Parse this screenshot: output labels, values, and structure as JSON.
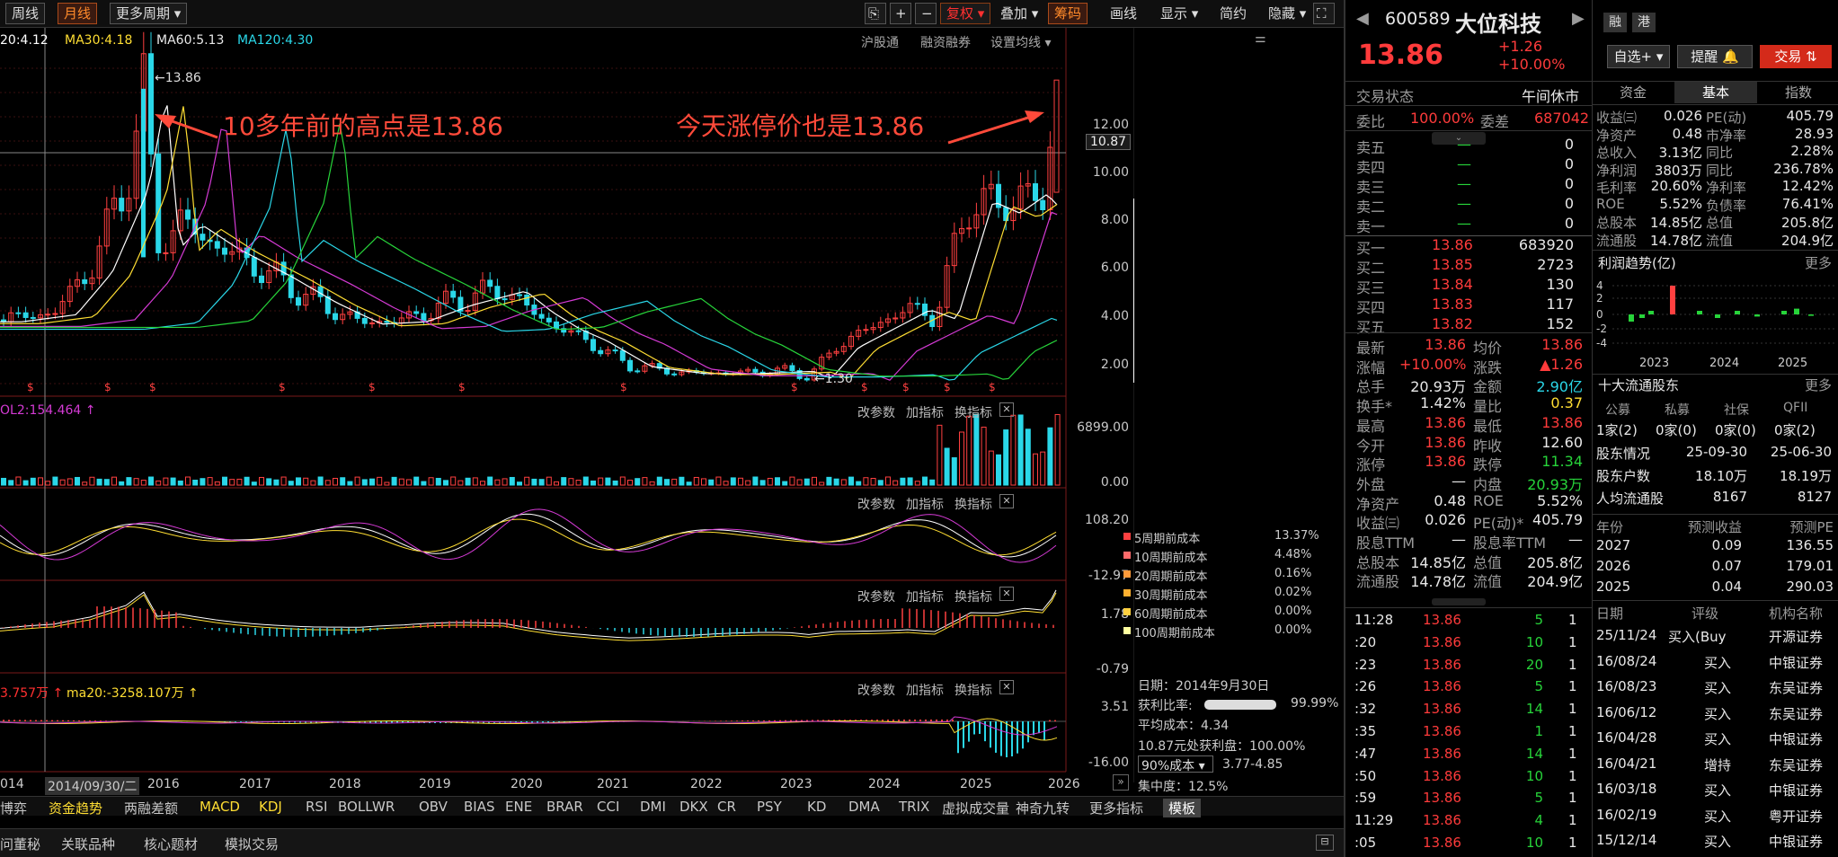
{
  "toolbar": {
    "buttons": [
      "周线",
      "月线",
      "更多周期",
      "复权",
      "叠加",
      "筹码",
      "画线",
      "显示",
      "简约",
      "隐藏"
    ],
    "icons": [
      "lock-icon",
      "plus-icon",
      "minus-icon",
      "fullscreen-icon"
    ]
  },
  "chart": {
    "ma_row": {
      "ma20": "20:4.12",
      "ma30": "MA30:4.18",
      "ma60": "MA60:5.13",
      "ma120": "MA120:4.30"
    },
    "top_links": [
      "沪股通",
      "融资融券",
      "设置均线"
    ],
    "ann_left": "10多年前的高点是13.86",
    "ann_right": "今天涨停价也是13.86",
    "high_label": "13.86",
    "low_label": "1.30",
    "crosshair_value": "10.87",
    "price_ticks": [
      "12.00",
      "10.00",
      "8.00",
      "6.00",
      "4.00",
      "2.00"
    ],
    "vol": {
      "label": "OL2:154.464",
      "max": "6899.00",
      "min": "0.00"
    },
    "ind2": {
      "max": "108.20",
      "min": "-12.97"
    },
    "ind3": {
      "max": "1.78",
      "min": "-0.79"
    },
    "ind4": {
      "label1": "3.757万",
      "label2": "ma20:-3258.107万",
      "max": "3.51",
      "min": "-16.00"
    },
    "panel_links": [
      "改参数",
      "加指标",
      "换指标"
    ],
    "years": [
      "014",
      "2014/09/30/二",
      "2016",
      "2017",
      "2018",
      "2019",
      "2020",
      "2021",
      "2022",
      "2023",
      "2024",
      "2025",
      "2026"
    ],
    "chip": {
      "rows": [
        {
          "label": "5周期前成本",
          "value": "13.37%",
          "color": "#ff4040"
        },
        {
          "label": "10周期前成本",
          "value": "4.48%",
          "color": "#ff6b6b"
        },
        {
          "label": "20周期前成本",
          "value": "0.16%",
          "color": "#ff9a3a"
        },
        {
          "label": "30周期前成本",
          "value": "0.02%",
          "color": "#ffb030"
        },
        {
          "label": "60周期前成本",
          "value": "0.00%",
          "color": "#ffd040"
        },
        {
          "label": "100周期前成本",
          "value": "0.00%",
          "color": "#ffffa0"
        }
      ],
      "date": "日期：2014年9月30日",
      "profit_ratio_label": "获利比率:",
      "profit_ratio": "99.99%",
      "avg_cost_label": "平均成本：",
      "avg_cost": "4.34",
      "profit_at": "10.87元处获利盘：100.00%",
      "cost_select": "90%成本",
      "cost_range": "3.77-4.85",
      "concentration": "集中度：12.5%"
    }
  },
  "bottom_tabs": [
    "博弈",
    "资金趋势",
    "两融差额",
    "MACD",
    "KDJ",
    "RSI",
    "BOLL",
    "WR",
    "OBV",
    "BIAS",
    "ENE",
    "BRAR",
    "CCI",
    "DMI",
    "DKX",
    "CR",
    "PSY",
    "KD",
    "DMA",
    "TRIX",
    "虚拟成交量",
    "神奇九转",
    "更多指标",
    "模板"
  ],
  "footer_tabs": [
    "问董秘",
    "关联品种",
    "核心题材",
    "模拟交易"
  ],
  "quote": {
    "code": "600589",
    "name": "大位科技",
    "price": "13.86",
    "change": "+1.26",
    "pct": "+10.00%",
    "tags": [
      "融",
      "港"
    ],
    "status": "交易状态",
    "status_val": "午间休市",
    "weibi": "委比",
    "weibi_val": "100.00%",
    "weicha": "委差",
    "weicha_val": "687042",
    "sells": [
      {
        "l": "卖五",
        "p": "—",
        "v": "0"
      },
      {
        "l": "卖四",
        "p": "—",
        "v": "0"
      },
      {
        "l": "卖三",
        "p": "—",
        "v": "0"
      },
      {
        "l": "卖二",
        "p": "—",
        "v": "0"
      },
      {
        "l": "卖一",
        "p": "—",
        "v": "0"
      }
    ],
    "buys": [
      {
        "l": "买一",
        "p": "13.86",
        "v": "683920"
      },
      {
        "l": "买二",
        "p": "13.85",
        "v": "2723"
      },
      {
        "l": "买三",
        "p": "13.84",
        "v": "130"
      },
      {
        "l": "买四",
        "p": "13.83",
        "v": "117"
      },
      {
        "l": "买五",
        "p": "13.82",
        "v": "152"
      }
    ],
    "stats": [
      [
        "最新",
        "13.86",
        "均价",
        "13.86"
      ],
      [
        "涨幅",
        "+10.00%",
        "涨跌",
        "▲1.26"
      ],
      [
        "总手",
        "20.93万",
        "金额",
        "2.90亿"
      ],
      [
        "换手*",
        "1.42%",
        "量比",
        "0.37"
      ],
      [
        "最高",
        "13.86",
        "最低",
        "13.86"
      ],
      [
        "今开",
        "13.86",
        "昨收",
        "12.60"
      ],
      [
        "涨停",
        "13.86",
        "跌停",
        "11.34"
      ],
      [
        "外盘",
        "—",
        "内盘",
        "20.93万"
      ],
      [
        "净资产",
        "0.48",
        "ROE",
        "5.52%"
      ],
      [
        "收益㈢",
        "0.026",
        "PE(动)*",
        "405.79"
      ],
      [
        "股息TTM",
        "—",
        "股息率TTM",
        "—"
      ],
      [
        "总股本",
        "14.85亿",
        "总值",
        "205.8亿"
      ],
      [
        "流通股",
        "14.78亿",
        "流值",
        "204.9亿"
      ]
    ],
    "ticks": [
      [
        "11:28",
        "13.86",
        "5",
        "1"
      ],
      [
        ":20",
        "13.86",
        "10",
        "1"
      ],
      [
        ":23",
        "13.86",
        "20",
        "1"
      ],
      [
        ":26",
        "13.86",
        "5",
        "1"
      ],
      [
        ":32",
        "13.86",
        "14",
        "1"
      ],
      [
        ":35",
        "13.86",
        "1",
        "1"
      ],
      [
        ":47",
        "13.86",
        "14",
        "1"
      ],
      [
        ":50",
        "13.86",
        "10",
        "1"
      ],
      [
        ":59",
        "13.86",
        "5",
        "1"
      ],
      [
        "11:29",
        "13.86",
        "4",
        "1"
      ],
      [
        ":05",
        "13.86",
        "10",
        "1"
      ]
    ]
  },
  "right": {
    "buttons": [
      "自选+",
      "提醒",
      "交易"
    ],
    "tabs": [
      "资金",
      "基本",
      "指数"
    ],
    "fund": [
      [
        "收益㈢",
        "0.026",
        "PE(动)",
        "405.79"
      ],
      [
        "净资产",
        "0.48",
        "市净率",
        "28.93"
      ],
      [
        "总收入",
        "3.13亿",
        "同比",
        "2.28%"
      ],
      [
        "净利润",
        "3803万",
        "同比",
        "236.78%"
      ],
      [
        "毛利率",
        "20.60%",
        "净利率",
        "12.42%"
      ],
      [
        "ROE",
        "5.52%",
        "负债率",
        "76.41%"
      ],
      [
        "总股本",
        "14.85亿",
        "总值",
        "205.8亿"
      ],
      [
        "流通股",
        "14.78亿",
        "流值",
        "204.9亿"
      ]
    ],
    "profit_title": "利润趋势(亿)",
    "more": "更多",
    "profit_axis": [
      "4",
      "2",
      "0",
      "-2",
      "-4"
    ],
    "profit_years": [
      "2023",
      "2024",
      "2025"
    ],
    "holders_title": "十大流通股东",
    "holder_types": [
      "公募",
      "私募",
      "社保",
      "QFII"
    ],
    "holder_counts": [
      "1家(2)",
      "0家(0)",
      "0家(0)",
      "0家(2)"
    ],
    "holder_rows": [
      [
        "股东情况",
        "25-09-30",
        "25-06-30"
      ],
      [
        "股东户数",
        "18.10万",
        "18.19万"
      ],
      [
        "人均流通股",
        "8167",
        "8127"
      ]
    ],
    "forecast_head": [
      "年份",
      "预测收益",
      "预测PE"
    ],
    "forecast": [
      [
        "2027",
        "0.09",
        "136.55"
      ],
      [
        "2026",
        "0.07",
        "179.01"
      ],
      [
        "2025",
        "0.04",
        "290.03"
      ]
    ],
    "rating_head": [
      "日期",
      "评级",
      "机构名称"
    ],
    "ratings": [
      [
        "25/11/24",
        "买入(Buy",
        "开源证券"
      ],
      [
        "16/08/24",
        "买入",
        "中银证券"
      ],
      [
        "16/08/23",
        "买入",
        "东吴证券"
      ],
      [
        "16/06/12",
        "买入",
        "东吴证券"
      ],
      [
        "16/04/28",
        "买入",
        "中银证券"
      ],
      [
        "16/04/21",
        "增持",
        "东吴证券"
      ],
      [
        "16/03/18",
        "买入",
        "中银证券"
      ],
      [
        "16/02/19",
        "买入",
        "粤开证券"
      ],
      [
        "15/12/14",
        "买入",
        "中银证券"
      ]
    ]
  }
}
